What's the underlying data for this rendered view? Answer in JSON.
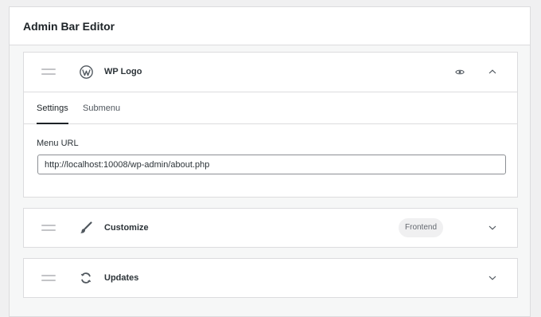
{
  "panel": {
    "title": "Admin Bar Editor"
  },
  "items": [
    {
      "label": "WP Logo",
      "icon": "wordpress-logo-icon",
      "expanded": true,
      "tabs": [
        {
          "label": "Settings",
          "active": true
        },
        {
          "label": "Submenu",
          "active": false
        }
      ],
      "menu_url_label": "Menu URL",
      "menu_url_value": "http://localhost:10008/wp-admin/about.php"
    },
    {
      "label": "Customize",
      "icon": "paintbrush-icon",
      "badge": "Frontend",
      "expanded": false
    },
    {
      "label": "Updates",
      "icon": "refresh-icon",
      "expanded": false
    }
  ],
  "colors": {
    "border": "#dcdcde",
    "background": "#f6f7f7",
    "text": "#1d2327",
    "muted": "#646970"
  }
}
